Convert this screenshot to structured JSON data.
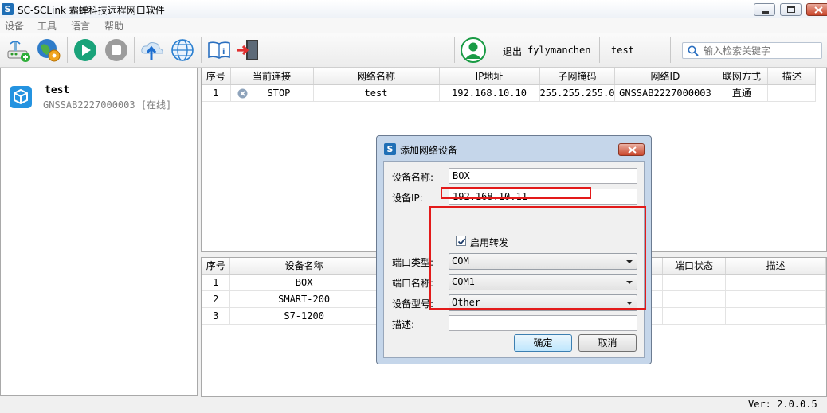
{
  "window": {
    "title": "SC-SCLink 霜蝉科技远程网口软件",
    "app_icon_letter": "S"
  },
  "menu": [
    "设备",
    "工具",
    "语言",
    "帮助"
  ],
  "toolbar": {
    "buttons": [
      "add-device-icon",
      "settings-globe-icon",
      "play-icon",
      "stop-icon",
      "upload-cloud-icon",
      "globe-icon",
      "manual-book-icon",
      "exit-door-icon"
    ],
    "exit_label": "退出",
    "username": "fylymanchen",
    "network_label": "test"
  },
  "search": {
    "placeholder": "输入检索关键字"
  },
  "left_panel": {
    "device_name": "test",
    "device_sub": "GNSSAB2227000003 [在线]"
  },
  "network_table": {
    "columns": [
      "序号",
      "当前连接",
      "网络名称",
      "IP地址",
      "子网掩码",
      "网络ID",
      "联网方式",
      "描述"
    ],
    "rows": [
      {
        "index": "1",
        "connection": "STOP",
        "name": "test",
        "ip": "192.168.10.10",
        "mask": "255.255.255.0",
        "net_id": "GNSSAB2227000003",
        "mode": "直通",
        "desc": ""
      }
    ]
  },
  "device_table": {
    "columns": [
      "序号",
      "设备名称",
      "端口状态",
      "描述"
    ],
    "rows": [
      {
        "index": "1",
        "name": "BOX"
      },
      {
        "index": "2",
        "name": "SMART-200"
      },
      {
        "index": "3",
        "name": "S7-1200"
      }
    ]
  },
  "status": {
    "version": "Ver: 2.0.0.5"
  },
  "dialog": {
    "title": "添加网络设备",
    "icon_letter": "S",
    "device_name_label": "设备名称:",
    "device_name_value": "BOX",
    "device_ip_label": "设备IP:",
    "device_ip_value": "192.168.10.11",
    "forward_label": "启用转发",
    "forward_checked": true,
    "port_type_label": "端口类型:",
    "port_type_value": "COM",
    "port_name_label": "端口名称:",
    "port_name_value": "COM1",
    "device_model_label": "设备型号:",
    "device_model_value": "Other",
    "desc_label": "描述:",
    "desc_value": "",
    "ok_label": "确定",
    "cancel_label": "取消"
  },
  "colors": {
    "highlight": "#e31a1a",
    "accent": "#1f6fb6"
  }
}
